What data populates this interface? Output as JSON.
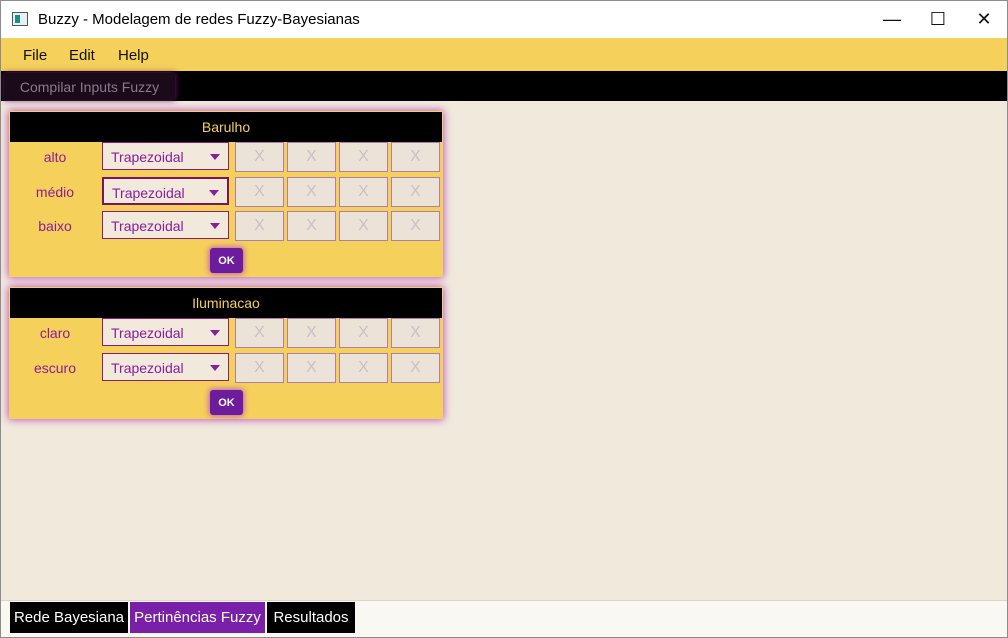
{
  "window": {
    "title": "Buzzy - Modelagem de redes Fuzzy-Bayesianas",
    "controls": {
      "minimize": "—",
      "maximize": "☐",
      "close": "✕"
    }
  },
  "menubar": {
    "items": [
      "File",
      "Edit",
      "Help"
    ]
  },
  "toolbar": {
    "compile_label": "Compilar Inputs Fuzzy"
  },
  "variables": [
    {
      "name": "Barulho",
      "ok_label": "OK",
      "terms": [
        {
          "label": "alto",
          "function": "Trapezoidal",
          "params": [
            "X",
            "X",
            "X",
            "X"
          ]
        },
        {
          "label": "médio",
          "function": "Trapezoidal",
          "params": [
            "X",
            "X",
            "X",
            "X"
          ]
        },
        {
          "label": "baixo",
          "function": "Trapezoidal",
          "params": [
            "X",
            "X",
            "X",
            "X"
          ]
        }
      ]
    },
    {
      "name": "Iluminacao",
      "ok_label": "OK",
      "terms": [
        {
          "label": "claro",
          "function": "Trapezoidal",
          "params": [
            "X",
            "X",
            "X",
            "X"
          ]
        },
        {
          "label": "escuro",
          "function": "Trapezoidal",
          "params": [
            "X",
            "X",
            "X",
            "X"
          ]
        }
      ]
    }
  ],
  "tabs": [
    {
      "label": "Rede Bayesiana",
      "active": false
    },
    {
      "label": "Pertinências Fuzzy",
      "active": true
    },
    {
      "label": "Resultados",
      "active": false
    }
  ],
  "colors": {
    "accent_yellow": "#f5d05a",
    "accent_purple": "#7a1fa8",
    "label_purple": "#8a1e99",
    "background": "#f0e9dc"
  }
}
